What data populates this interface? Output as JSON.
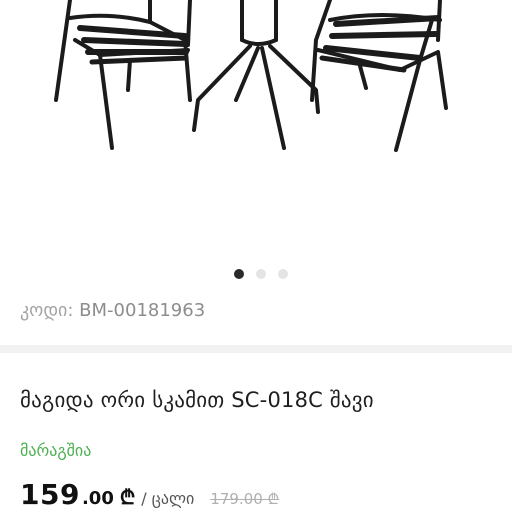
{
  "gallery": {
    "image_alt": "Black bistro table with two slatted chairs",
    "slides": [
      {
        "active": true
      },
      {
        "active": false
      },
      {
        "active": false
      }
    ]
  },
  "product": {
    "code_label": "კოდი:",
    "code_value": "BM-00181963",
    "title": "მაგიდა ორი სკამით SC-018C შავი",
    "availability": "მარაგშია",
    "price_main": "159",
    "price_cents": ".00",
    "currency": "₾",
    "unit": "/ ცალი",
    "old_price": "179.00 ₾"
  },
  "colors": {
    "in_stock": "#4caf50",
    "dot_active": "#2a2a2a",
    "dot_inactive": "#e4e4e4",
    "old_price": "#b0b0b0"
  }
}
